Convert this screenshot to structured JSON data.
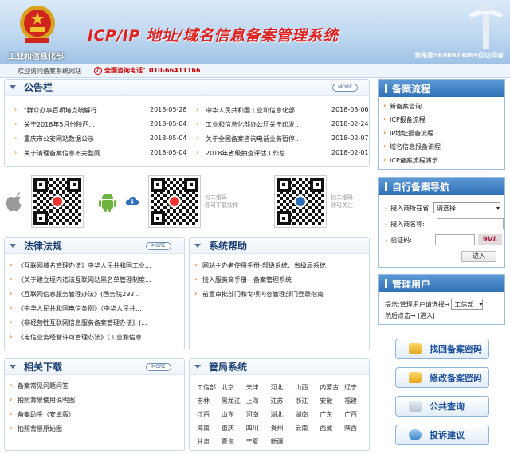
{
  "header": {
    "ministry": "工业和信息化部",
    "title": "ICP/IP 地址/域名信息备案管理系统",
    "visit_counter": "您是第5698973069位访问者"
  },
  "subbar": {
    "welcome": "欢迎访问备案系统网站",
    "hotline": "全国咨询电话：010-66411166"
  },
  "announce": {
    "title": "公告栏",
    "more": "MORE",
    "left": [
      {
        "text": "\"群众办事百项堵点疏解行...",
        "date": "2018-05-28"
      },
      {
        "text": "关于2018年5月份陕西...",
        "date": "2018-05-04"
      },
      {
        "text": "重庆市公安网站数据公示",
        "date": "2018-05-04"
      },
      {
        "text": "关于清理备案信息不完整网...",
        "date": "2018-05-04"
      }
    ],
    "right": [
      {
        "text": "中华人民共和国工业和信息化部...",
        "date": "2018-03-06"
      },
      {
        "text": "工业和信息化部办公厅关于印发...",
        "date": "2018-02-24"
      },
      {
        "text": "关于全国备案咨询电话业务暂停...",
        "date": "2018-02-07"
      },
      {
        "text": "2018年省级抽查评估工作总...",
        "date": "2018-02-01"
      }
    ]
  },
  "qr": {
    "download_hint": "扫二维码\n即可下载软件",
    "follow_hint": "扫二维码\n即可关注"
  },
  "law": {
    "title": "法律法规",
    "more": "MORE",
    "items": [
      "《互联网域名管理办法》中华人民共和国工业...",
      "《关于建立境内违法互联网站黑名单管理制度...",
      "《互联网信息服务管理办法》(国务院292...",
      "《中华人民共和国电信条例》（中华人民共...",
      "《非经营性互联网信息服务备案管理办法》(...",
      "《电信业务经营许可管理办法》（工业和信息..."
    ]
  },
  "help": {
    "title": "系统帮助",
    "items": [
      "网站主办者使用手册-部级系统、省级局系统",
      "接入服务商手册—备案管理系统",
      "前置审批部门和专项内容管理部门登录指南"
    ]
  },
  "download": {
    "title": "相关下载",
    "more": "MORE",
    "items": [
      "备案常见问题问答",
      "拍照背景使用说明图",
      "备案助手（安卓版）",
      "拍照背景原始图"
    ]
  },
  "bureau": {
    "title": "管局系统",
    "provinces": [
      [
        "工信部",
        "北京",
        "天津",
        "河北",
        "山西",
        "内蒙古",
        "辽宁"
      ],
      [
        "吉林",
        "黑龙江",
        "上海",
        "江苏",
        "浙江",
        "安徽",
        "福建"
      ],
      [
        "江西",
        "山东",
        "河南",
        "湖北",
        "湖南",
        "广东",
        "广西"
      ],
      [
        "海南",
        "重庆",
        "四川",
        "贵州",
        "云南",
        "西藏",
        "陕西"
      ],
      [
        "甘肃",
        "青海",
        "宁夏",
        "新疆",
        "",
        "",
        ""
      ]
    ]
  },
  "flow": {
    "title": "备案流程",
    "items": [
      "新备案咨询",
      "ICP报备流程",
      "IP地址报备流程",
      "域名信息报备流程",
      "ICP备案流程演示"
    ]
  },
  "nav": {
    "title": "自行备案导航",
    "province_label": "接入商所在省:",
    "province_value": "请选择",
    "isp_label": "接入商名称:",
    "captcha_label": "验证码:",
    "captcha_text": "9VL",
    "enter": "进入"
  },
  "manage": {
    "title": "管理用户",
    "hint1": "提示:管理用户请选择→",
    "select_value": "工信部",
    "hint2": "然后点击→ |进入|"
  },
  "buttons": {
    "retrieve": "找回备案密码",
    "modify": "修改备案密码",
    "query": "公共查询",
    "complaint": "投诉建议"
  }
}
